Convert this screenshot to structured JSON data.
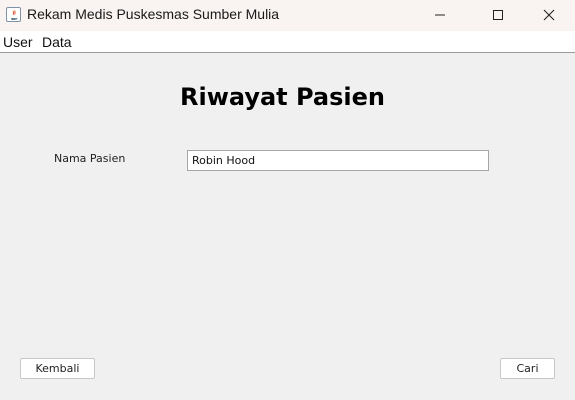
{
  "window": {
    "title": "Rekam Medis Puskesmas Sumber Mulia",
    "icon": "java-app-icon",
    "controls": [
      "minimize-icon",
      "maximize-icon",
      "close-icon"
    ]
  },
  "menu": {
    "items": [
      {
        "label": "User"
      },
      {
        "label": "Data"
      }
    ]
  },
  "main": {
    "title": "Riwayat Pasien",
    "nama_pasien_label": "Nama Pasien",
    "nama_pasien_value": "Robin Hood"
  },
  "buttons": {
    "back_label": "Kembali",
    "search_label": "Cari"
  },
  "colors": {
    "titlebar_bg": "#f9f3f1",
    "window_bg": "#f0f0f0",
    "menubar_bg": "#ffffff"
  }
}
